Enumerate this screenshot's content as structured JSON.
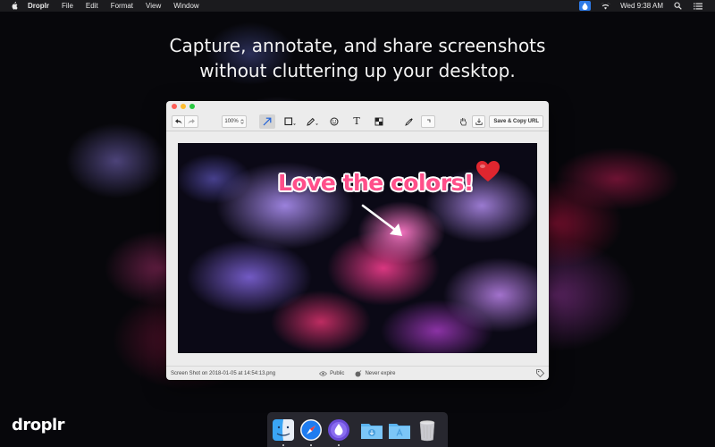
{
  "menubar": {
    "app_name": "Droplr",
    "menus": [
      "File",
      "Edit",
      "Format",
      "View",
      "Window"
    ],
    "clock": "Wed 9:38 AM"
  },
  "headline": {
    "line1": "Capture, annotate, and share screenshots",
    "line2": "without cluttering up your desktop."
  },
  "editor": {
    "zoom_value": "100%",
    "save_button_label": "Save & Copy URL",
    "text_tool_glyph": "T",
    "annotation_text": "Love the colors!",
    "filename": "Screen Shot on 2018-01-05 at 14:54:13.png",
    "visibility": "Public",
    "expiry": "Never expire",
    "colors": {
      "annotation": "#ff4f8a",
      "accent": "#2e7ae6"
    }
  },
  "dock": {
    "apps": [
      "finder-icon",
      "safari-icon",
      "droplr-icon",
      "downloads-folder-icon",
      "applications-folder-icon",
      "trash-icon"
    ]
  },
  "brand": {
    "logo_text": "droplr"
  }
}
